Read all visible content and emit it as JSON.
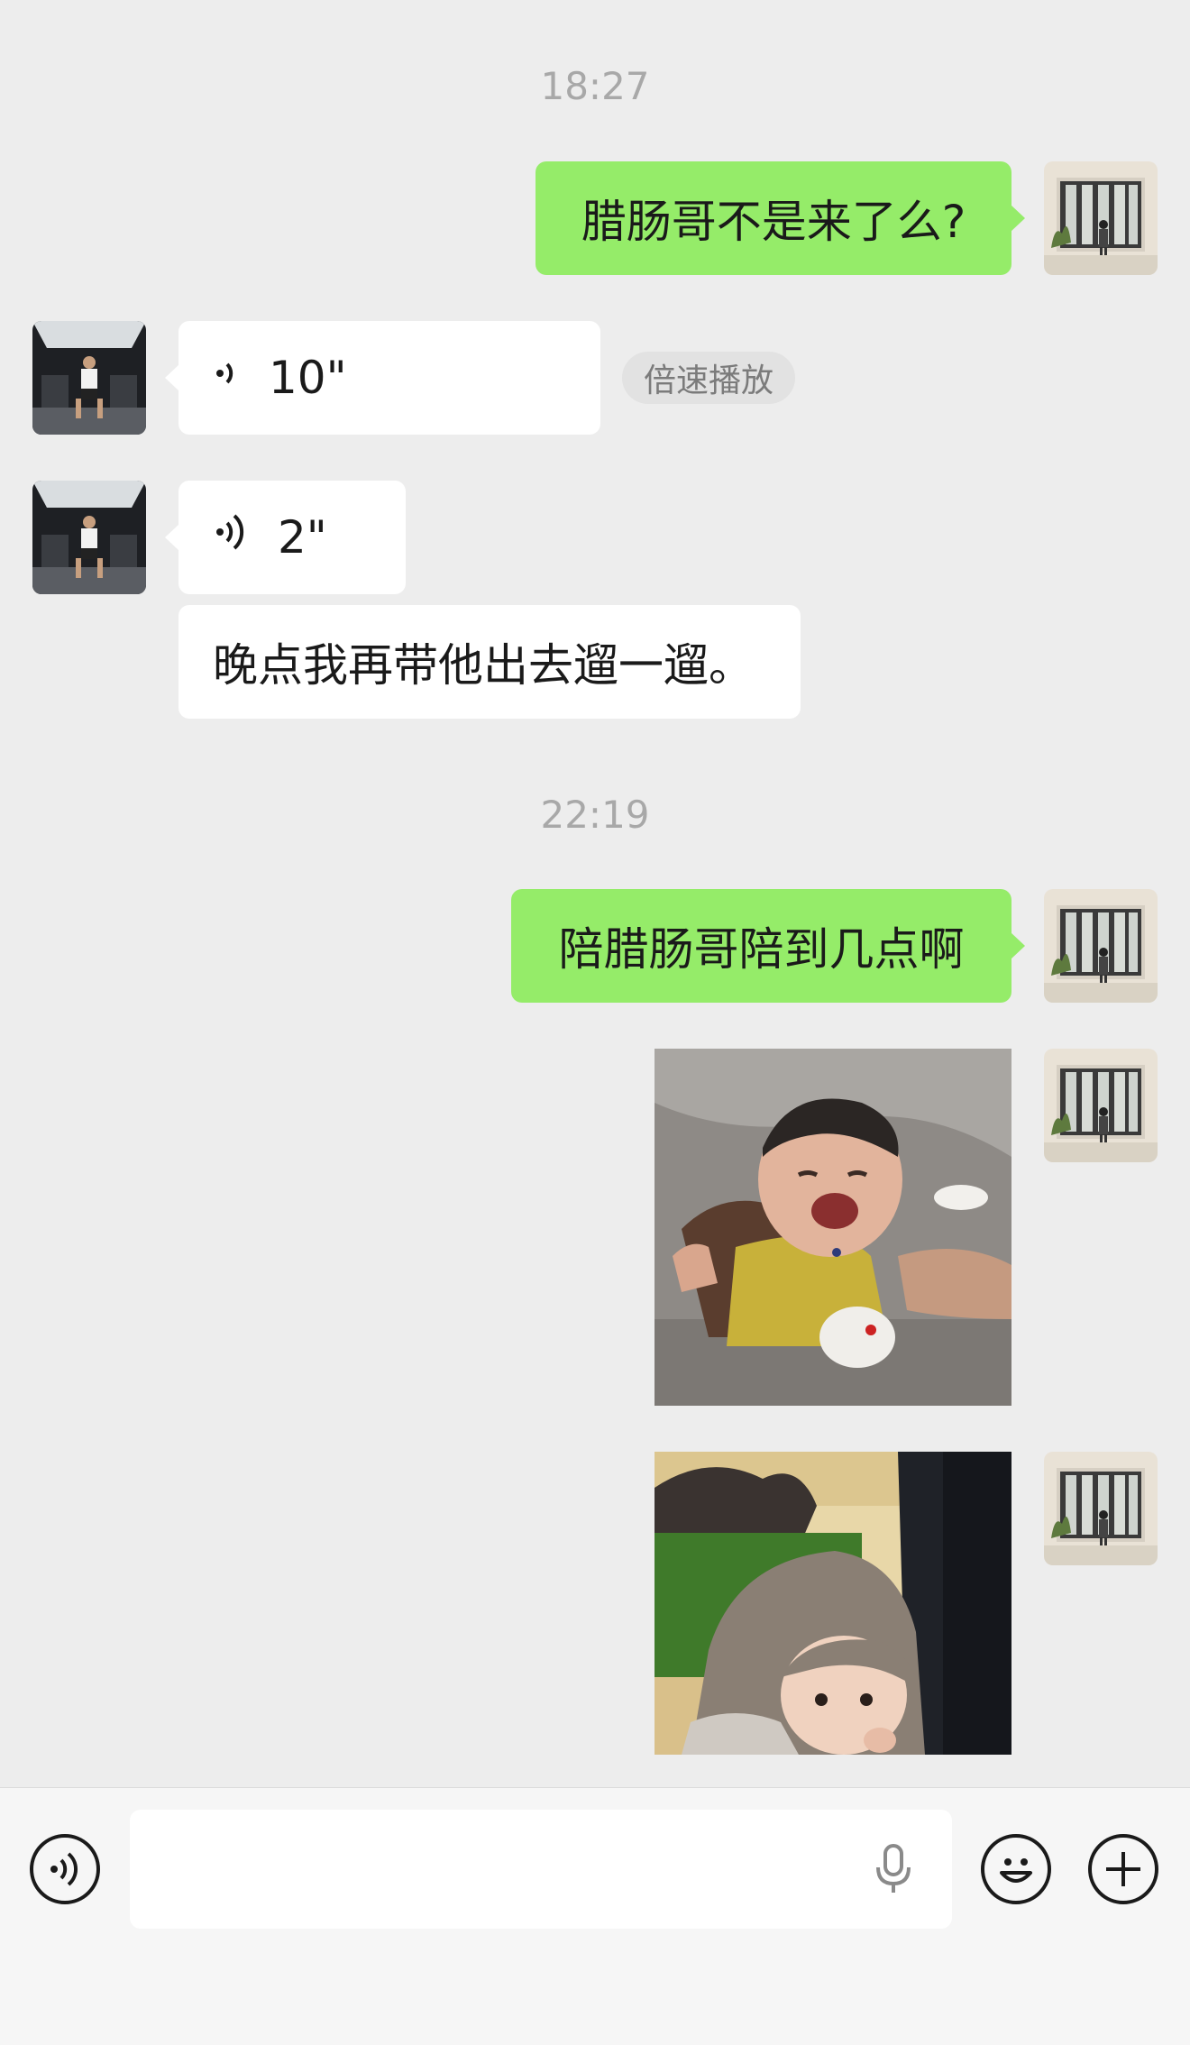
{
  "messages": {
    "time1": "18:27",
    "msg1": "腊肠哥不是来了么?",
    "voice1_duration": "10\"",
    "speed_play": "倍速播放",
    "voice2_duration": "2\"",
    "msg2": "晚点我再带他出去遛一遛。",
    "time2": "22:19",
    "msg3": "陪腊肠哥陪到几点啊"
  },
  "input": {
    "placeholder": "",
    "value": ""
  },
  "colors": {
    "background": "#ededed",
    "my_bubble": "#95ec69",
    "their_bubble": "#ffffff",
    "timestamp": "#a8a8a8",
    "bottom_bar": "#f6f6f6"
  },
  "icons": [
    "voice-mode-icon",
    "microphone-icon",
    "emoji-icon",
    "plus-icon",
    "voice-wave-icon"
  ]
}
